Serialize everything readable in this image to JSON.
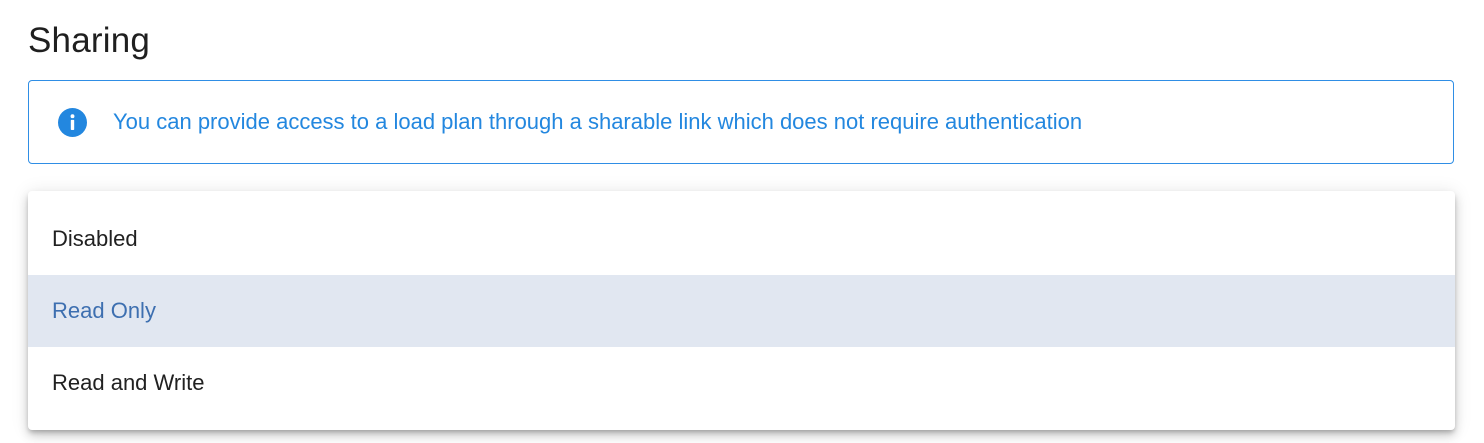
{
  "section": {
    "title": "Sharing"
  },
  "info": {
    "icon": "info-icon",
    "message": "You can provide access to a load plan through a sharable link which does not require authentication",
    "accent_color": "#2387df"
  },
  "sharing_select": {
    "selected_value": "Read Only",
    "options": [
      {
        "label": "Disabled",
        "selected": false
      },
      {
        "label": "Read Only",
        "selected": true
      },
      {
        "label": "Read and Write",
        "selected": false
      }
    ],
    "selected_background": "#e1e7f1",
    "selected_text_color": "#3d6fb0"
  }
}
